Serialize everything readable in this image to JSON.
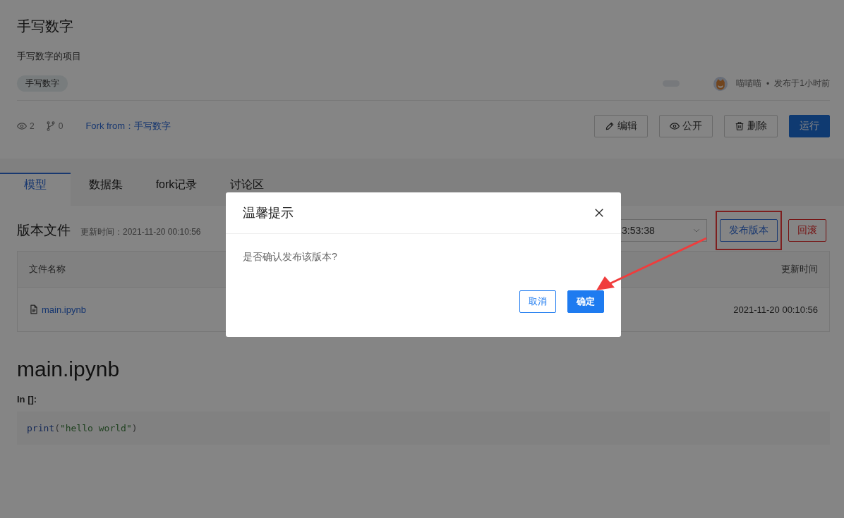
{
  "project": {
    "title": "手写数字",
    "description": "手写数字的项目",
    "tags": [
      "手写数字"
    ],
    "author": "喵喵喵",
    "separator": "•",
    "published": "发布于1小时前"
  },
  "stats": {
    "views": "2",
    "forks": "0",
    "fork_from_label": "Fork from：",
    "fork_from": "手写数字"
  },
  "actions": [
    {
      "label": "编辑",
      "kind": "edit"
    },
    {
      "label": "公开",
      "kind": "public"
    },
    {
      "label": "删除",
      "kind": "delete"
    },
    {
      "label": "运行",
      "kind": "run"
    }
  ],
  "tabs": [
    {
      "label": "模型",
      "selected": true
    },
    {
      "label": "数据集",
      "selected": false
    },
    {
      "label": "fork记录",
      "selected": false
    },
    {
      "label": "讨论区",
      "selected": false
    }
  ],
  "version": {
    "title": "版本文件",
    "updated_label": "更新时间：",
    "updated": "2021-11-20 00:10:56",
    "select_value": "3:53:38",
    "buttons": [
      {
        "label": "发布版本",
        "kind": "primary",
        "highlighted": true
      },
      {
        "label": "回滚",
        "kind": "danger",
        "highlighted": false
      }
    ]
  },
  "table": {
    "columns": [
      "文件名称",
      "更新时间"
    ],
    "rows": [
      {
        "name": "main.ipynb",
        "updated": "2021-11-20 00:10:56"
      }
    ]
  },
  "notebook": {
    "title": "main.ipynb",
    "cells": [
      {
        "prompt": "In []:",
        "code": [
          {
            "text": "print",
            "kind": "builtin"
          },
          {
            "text": "(",
            "kind": "punct"
          },
          {
            "text": "\"hello world\"",
            "kind": "string"
          },
          {
            "text": ")",
            "kind": "punct"
          }
        ]
      }
    ]
  },
  "dialog": {
    "title": "温馨提示",
    "message": "是否确认发布该版本?",
    "buttons": [
      {
        "label": "取消",
        "kind": "default"
      },
      {
        "label": "确定",
        "kind": "primary"
      }
    ]
  }
}
